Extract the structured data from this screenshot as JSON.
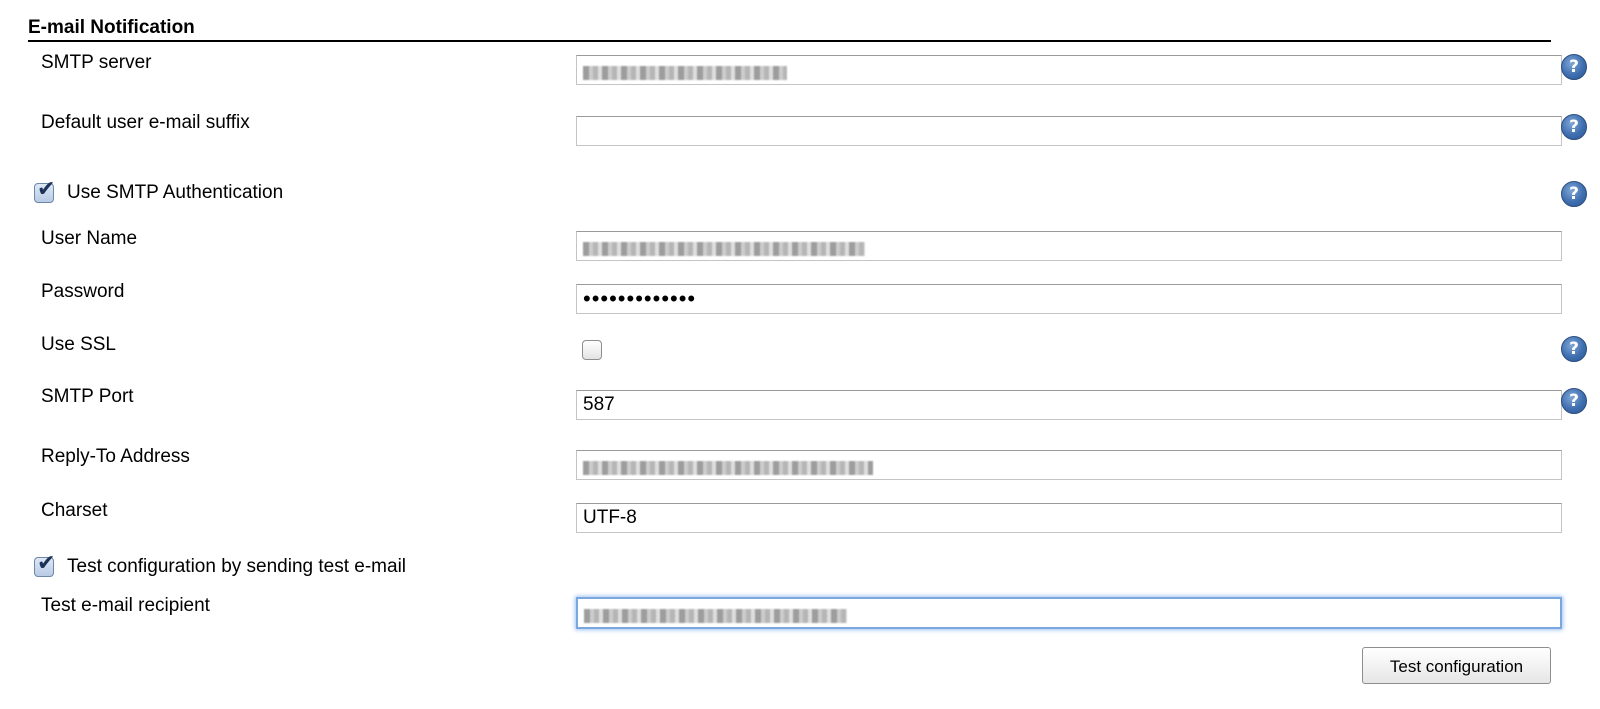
{
  "section": {
    "title": "E-mail Notification"
  },
  "help_icon": {
    "name": "help-icon",
    "glyph": "?",
    "color": "#3f6fb0"
  },
  "fields": {
    "smtp_server": {
      "label": "SMTP server",
      "value": ""
    },
    "default_suffix": {
      "label": "Default user e-mail suffix",
      "value": ""
    },
    "use_smtp_auth": {
      "label": "Use SMTP Authentication",
      "checked": true
    },
    "user_name": {
      "label": "User Name",
      "value": ""
    },
    "password": {
      "label": "Password",
      "value": "•••••••••••••"
    },
    "use_ssl": {
      "label": "Use SSL",
      "checked": false
    },
    "smtp_port": {
      "label": "SMTP Port",
      "value": "587"
    },
    "reply_to": {
      "label": "Reply-To Address",
      "value": ""
    },
    "charset": {
      "label": "Charset",
      "value": "UTF-8"
    },
    "test_config": {
      "label": "Test configuration by sending test e-mail",
      "checked": true
    },
    "test_recipient": {
      "label": "Test e-mail recipient",
      "value": ""
    }
  },
  "buttons": {
    "test_configuration": "Test configuration"
  },
  "colors": {
    "focus_ring": "#7aa7e0",
    "checkbox_checked": "#b8cbe5"
  }
}
